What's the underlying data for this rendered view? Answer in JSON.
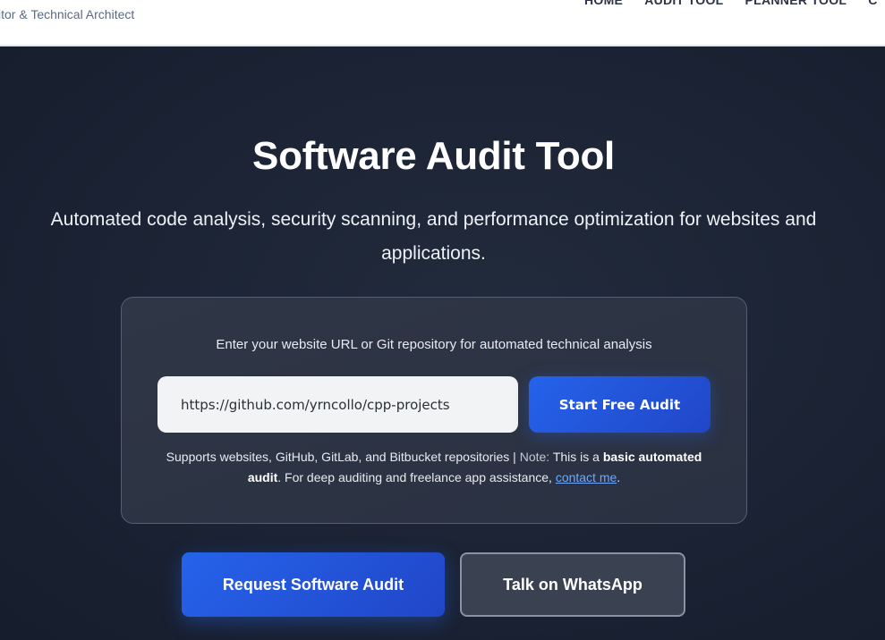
{
  "header": {
    "tagline": "itor & Technical Architect",
    "nav": [
      "HOME",
      "AUDIT TOOL",
      "PLANNER TOOL",
      "C"
    ]
  },
  "hero": {
    "title": "Software Audit Tool",
    "subtitle": "Automated code analysis, security scanning, and performance optimization for websites and applications."
  },
  "audit_card": {
    "prompt": "Enter your website URL or Git repository for automated technical analysis",
    "input_value": "https://github.com/yrncollo/cpp-projects",
    "start_button": "Start Free Audit",
    "note_supports": "Supports websites, GitHub, GitLab, and Bitbucket repositories |",
    "note_label": "Note:",
    "note_pre": "This is a",
    "note_bold": "basic automated audit",
    "note_post": ". For deep auditing and freelance app assistance,",
    "note_link": "contact me",
    "note_end": "."
  },
  "cta": {
    "request_button": "Request Software Audit",
    "whatsapp_button": "Talk on WhatsApp"
  },
  "colors": {
    "accent": "#2563eb",
    "hero_bg": "#1b2334",
    "link": "#6ea8ff"
  }
}
